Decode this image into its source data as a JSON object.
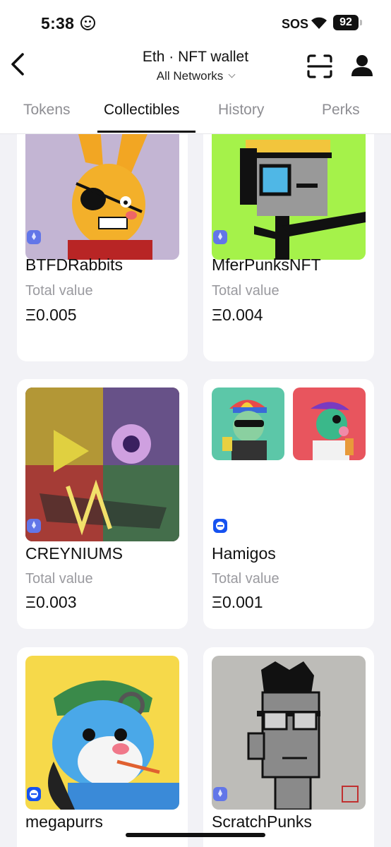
{
  "status": {
    "time": "5:38",
    "sos": "SOS",
    "battery": "92"
  },
  "header": {
    "title": "Eth · NFT wallet",
    "network": "All Networks"
  },
  "tabs": [
    {
      "label": "Tokens",
      "active": false
    },
    {
      "label": "Collectibles",
      "active": true
    },
    {
      "label": "History",
      "active": false
    },
    {
      "label": "Perks",
      "active": false
    }
  ],
  "collectibles": [
    {
      "name": "BTFDRabbits",
      "label": "Total value",
      "value": "Ξ0.005",
      "chain": "eth"
    },
    {
      "name": "MferPunksNFT",
      "label": "Total value",
      "value": "Ξ0.004",
      "chain": "eth"
    },
    {
      "name": "CREYNIUMS",
      "label": "Total value",
      "value": "Ξ0.003",
      "chain": "eth"
    },
    {
      "name": "Hamigos",
      "label": "Total value",
      "value": "Ξ0.001",
      "chain": "base"
    },
    {
      "name": "megapurrs",
      "chain": "base"
    },
    {
      "name": "ScratchPunks",
      "chain": "eth"
    }
  ],
  "icons": {
    "back": "chevron-left-icon",
    "scan": "scan-icon",
    "profile": "user-icon"
  }
}
